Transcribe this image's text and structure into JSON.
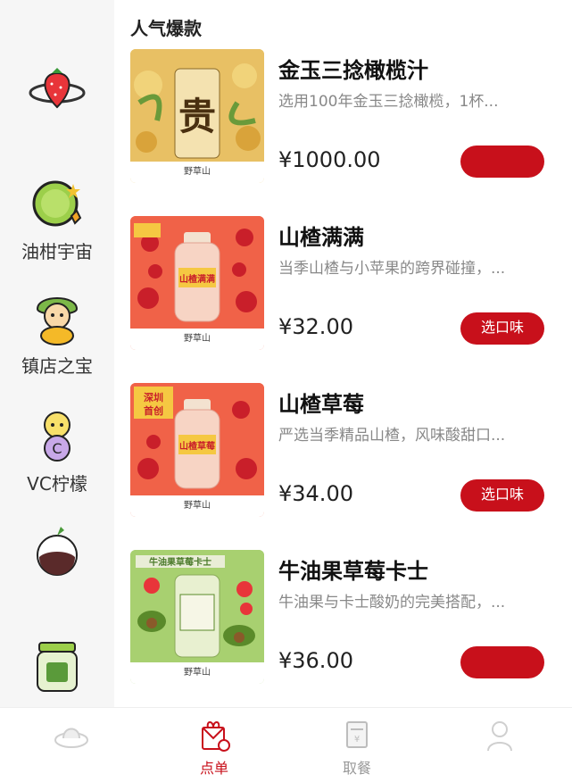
{
  "sidebar": {
    "items": [
      {
        "label": "",
        "icon": "planet-strawberry-icon"
      },
      {
        "label": "油柑宇宙",
        "icon": "lime-character-icon"
      },
      {
        "label": "镇店之宝",
        "icon": "mascot-icon"
      },
      {
        "label": "VC柠檬",
        "icon": "lemon-character-icon"
      },
      {
        "label": "",
        "icon": "fruit-cup-icon"
      },
      {
        "label": "",
        "icon": "jar-icon"
      }
    ]
  },
  "main": {
    "section_title": "人气爆款",
    "products": [
      {
        "name": "金玉三捻橄榄汁",
        "desc": "选用100年金玉三捻橄榄，1杯...",
        "price": "¥1000.00",
        "button": "",
        "image_text": "贵",
        "brand": "野草山"
      },
      {
        "name": "山楂满满",
        "desc": "当季山楂与小苹果的跨界碰撞，...",
        "price": "¥32.00",
        "button": "选口味",
        "image_text": "山楂满满",
        "brand": "野草山"
      },
      {
        "name": "山楂草莓",
        "desc": "严选当季精品山楂，风味酸甜口...",
        "price": "¥34.00",
        "button": "选口味",
        "image_text": "山楂草莓",
        "brand": "野草山",
        "badge": "深圳首创"
      },
      {
        "name": "牛油果草莓卡士",
        "desc": "牛油果与卡士酸奶的完美搭配，...",
        "price": "¥36.00",
        "button": "",
        "image_text": "牛油果草莓卡士",
        "brand": "野草山"
      }
    ]
  },
  "tabbar": {
    "tabs": [
      {
        "label": "",
        "icon": "home-icon"
      },
      {
        "label": "点单",
        "icon": "order-gift-icon",
        "active": true
      },
      {
        "label": "取餐",
        "icon": "pickup-receipt-icon"
      },
      {
        "label": "",
        "icon": "profile-icon"
      }
    ]
  },
  "colors": {
    "accent": "#c8101b",
    "sidebar_bg": "#f6f6f6"
  }
}
